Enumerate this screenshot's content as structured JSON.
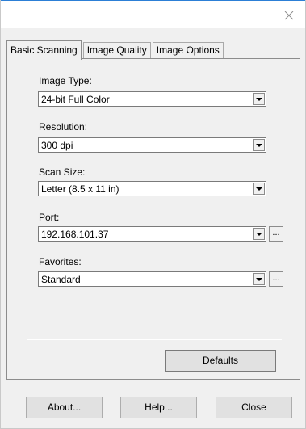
{
  "window": {
    "close_icon": "close-icon"
  },
  "tabs": [
    {
      "label": "Basic Scanning",
      "active": true
    },
    {
      "label": "Image Quality",
      "active": false
    },
    {
      "label": "Image Options",
      "active": false
    }
  ],
  "fields": {
    "image_type": {
      "label": "Image Type:",
      "value": "24-bit Full Color"
    },
    "resolution": {
      "label": "Resolution:",
      "value": "300 dpi"
    },
    "scan_size": {
      "label": "Scan Size:",
      "value": "Letter (8.5 x 11 in)"
    },
    "port": {
      "label": "Port:",
      "value": "192.168.101.37",
      "browse_label": "..."
    },
    "favorites": {
      "label": "Favorites:",
      "value": "Standard",
      "browse_label": "..."
    }
  },
  "buttons": {
    "defaults": "Defaults",
    "about": "About...",
    "help": "Help...",
    "close": "Close"
  }
}
